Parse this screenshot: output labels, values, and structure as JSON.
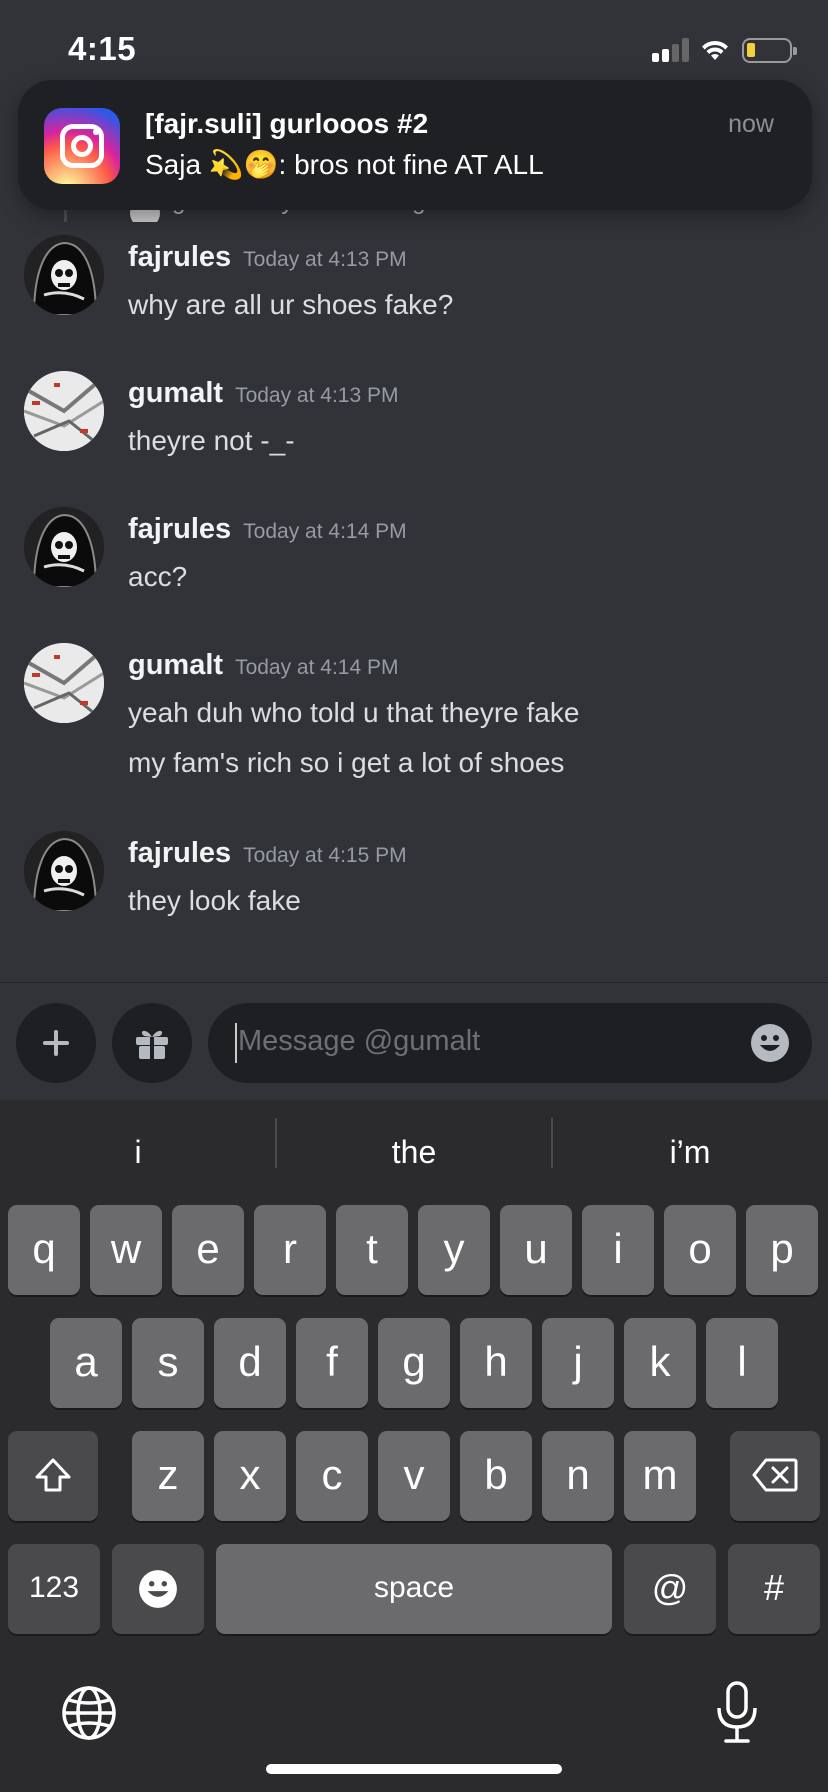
{
  "status_bar": {
    "time": "4:15"
  },
  "notification": {
    "app_icon": "instagram-icon",
    "title": "[fajr.suli] gurlooos #2",
    "body": "Saja 💫🤭: bros not fine AT ALL",
    "time": "now"
  },
  "reply_preview": {
    "text": "gumalt  why u defending him so hard ??"
  },
  "messages": [
    {
      "author": "fajrules",
      "time": "Today at 4:13 PM",
      "avatar": "reaper-avatar",
      "lines": [
        "why are all ur shoes fake?"
      ]
    },
    {
      "author": "gumalt",
      "time": "Today at 4:13 PM",
      "avatar": "sneaker-avatar",
      "lines": [
        "theyre not -_-"
      ]
    },
    {
      "author": "fajrules",
      "time": "Today at 4:14 PM",
      "avatar": "reaper-avatar",
      "lines": [
        "acc?"
      ]
    },
    {
      "author": "gumalt",
      "time": "Today at 4:14 PM",
      "avatar": "sneaker-avatar",
      "lines": [
        "yeah duh who told u that theyre fake",
        "my fam's rich so i get a lot of shoes"
      ]
    },
    {
      "author": "fajrules",
      "time": "Today at 4:15 PM",
      "avatar": "reaper-avatar",
      "lines": [
        "they look fake"
      ]
    }
  ],
  "composer": {
    "placeholder": "Message @gumalt",
    "add_icon": "plus-icon",
    "gift_icon": "gift-icon",
    "emoji_icon": "emoji-icon"
  },
  "keyboard": {
    "suggestions": [
      "i",
      "the",
      "i’m"
    ],
    "row1": [
      "q",
      "w",
      "e",
      "r",
      "t",
      "y",
      "u",
      "i",
      "o",
      "p"
    ],
    "row2": [
      "a",
      "s",
      "d",
      "f",
      "g",
      "h",
      "j",
      "k",
      "l"
    ],
    "row3": [
      "z",
      "x",
      "c",
      "v",
      "b",
      "n",
      "m"
    ],
    "numbers_label": "123",
    "space_label": "space",
    "at_label": "@",
    "hash_label": "#",
    "shift_icon": "shift-icon",
    "delete_icon": "backspace-icon",
    "emoji_icon": "emoji-keyboard-icon",
    "globe_icon": "globe-icon",
    "mic_icon": "microphone-icon"
  }
}
